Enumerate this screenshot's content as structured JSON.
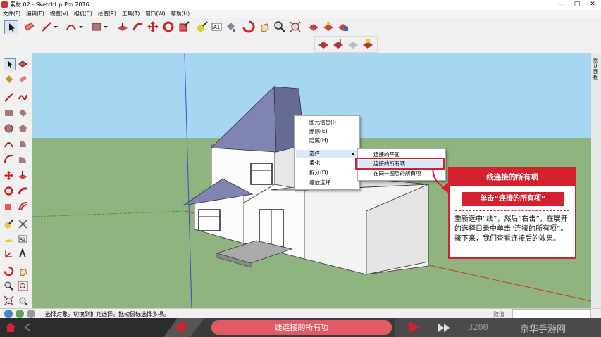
{
  "window": {
    "title": "素材 02 - SketchUp Pro 2016"
  },
  "menubar": [
    "文件(F)",
    "编辑(E)",
    "视图(V)",
    "相机(C)",
    "绘图(R)",
    "工具(T)",
    "窗口(W)",
    "帮助(H)"
  ],
  "right_panel": {
    "label": "默认面板"
  },
  "context_menu": {
    "items": [
      "图元信息(I)",
      "删除(E)",
      "隐藏(H)",
      "选择",
      "柔化",
      "拆分(D)",
      "缩放选择"
    ],
    "submenu_arrow": "▸"
  },
  "submenu": {
    "items": [
      "连接的平面",
      "连接的所有项",
      "在同一图层的所有项"
    ]
  },
  "callout": {
    "header": "线连接的所有项",
    "subheader": "单击“连接的所有项”",
    "body": "重新选中“线”，然后“右击”，在展开的选择目录中单击“连接的所有项”。接下来，我们查看连接后的效果。"
  },
  "status": {
    "text": "选择对象。切换到扩充选择。拖动鼠标选择多项。",
    "measure_label": "数值"
  },
  "bottom_bar": {
    "caption": "线连接的所有项",
    "counter": "3200",
    "watermark": "京华手游网"
  },
  "colors": {
    "accent": "#d4202f",
    "sky": "#a7d6f2",
    "ground": "#8fb47f",
    "roof": "#7f84b2",
    "wall": "#f7f7f7"
  }
}
